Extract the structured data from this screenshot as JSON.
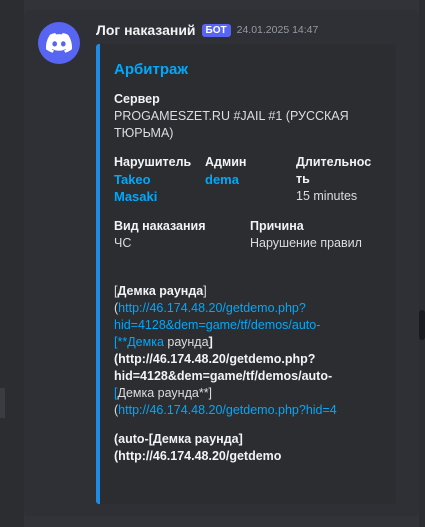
{
  "message": {
    "author": "Лог наказаний",
    "badge": "БОТ",
    "timestamp": "24.01.2025 14:47",
    "avatar_icon": "discord-logo-icon",
    "accent_color": "#1e8ce6"
  },
  "embed": {
    "title": "Арбитраж",
    "server_label": "Сервер",
    "server_value_line1": "PROGAMESZET.RU #JAIL #1 (РУССКАЯ",
    "server_value_line2": "ТЮРЬМА)",
    "violator_label": "Нарушитель",
    "violator_line1": "Takeo",
    "violator_line2": "Masaki",
    "admin_label": "Админ",
    "admin_value": "dema",
    "duration_label_line1": "Длительнос",
    "duration_label_line2": "ть",
    "duration_value": "15 minutes",
    "punishment_label": "Вид наказания",
    "punishment_value": "ЧС",
    "reason_label": "Причина",
    "reason_value": "Нарушение правил",
    "desc": {
      "l1_open": "[",
      "l1_bold": "Демка раунда",
      "l1_close": "]",
      "l2_open": "(",
      "l2_link": "http://46.174.48.20/getdemo.php?",
      "l3_link": "hid=4128&dem=game/tf/demos/auto-",
      "l4_link": "[**Демка",
      "l4_text": " раунда",
      "l4_close": "]",
      "l5_open": "(",
      "l5_link": "http://46.174.48.20/getdemo.php?",
      "l6_link": "hid=4128&dem=game/tf/demos/auto-",
      "l7_link": "[",
      "l7_text": "Демка раунда**]",
      "l8_open": "(",
      "l8_link": "http://46.174.48.20/getdemo.php?hid=4",
      "l9_open": "(auto-[",
      "l9_bold": "Демка раунда",
      "l9_close": "]",
      "l10_open": "(",
      "l10_link": "http://46.174.48.20/getdemo"
    }
  }
}
